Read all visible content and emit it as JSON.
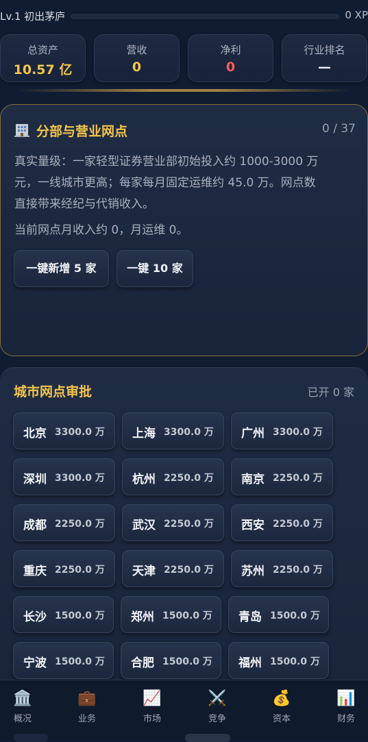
{
  "xp": {
    "level": "Lv.1 初出茅庐",
    "value": "0 XP"
  },
  "stats": [
    {
      "label": "总资产",
      "value": "10.57 亿"
    },
    {
      "label": "营收",
      "value": "0"
    },
    {
      "label": "净利",
      "value": "0"
    },
    {
      "label": "行业排名",
      "value": "—"
    }
  ],
  "branch": {
    "title": "分部与营业网点",
    "count": "0 / 37",
    "desc_lines": [
      "真实量级：一家轻型证券营业部初始投入约 1000-3000 万",
      "元，一线城市更高；每家每月固定运维约 45.0 万。网点数",
      "直接带来经纪与代销收入。"
    ],
    "current": "当前网点月收入约 0，月运维 0。",
    "buttons": [
      "一键新增 5 家",
      "一键 10 家"
    ]
  },
  "cities": {
    "title": "城市网点审批",
    "opened": "已开 0 家",
    "items": [
      {
        "name": "北京",
        "price": "3300.0 万"
      },
      {
        "name": "上海",
        "price": "3300.0 万"
      },
      {
        "name": "广州",
        "price": "3300.0 万"
      },
      {
        "name": "深圳",
        "price": "3300.0 万"
      },
      {
        "name": "杭州",
        "price": "2250.0 万"
      },
      {
        "name": "南京",
        "price": "2250.0 万"
      },
      {
        "name": "成都",
        "price": "2250.0 万"
      },
      {
        "name": "武汉",
        "price": "2250.0 万"
      },
      {
        "name": "西安",
        "price": "2250.0 万"
      },
      {
        "name": "重庆",
        "price": "2250.0 万"
      },
      {
        "name": "天津",
        "price": "2250.0 万"
      },
      {
        "name": "苏州",
        "price": "2250.0 万"
      },
      {
        "name": "长沙",
        "price": "1500.0 万"
      },
      {
        "name": "郑州",
        "price": "1500.0 万"
      },
      {
        "name": "青岛",
        "price": "1500.0 万"
      },
      {
        "name": "宁波",
        "price": "1500.0 万"
      },
      {
        "name": "合肥",
        "price": "1500.0 万"
      },
      {
        "name": "福州",
        "price": "1500.0 万"
      }
    ]
  },
  "nav": [
    {
      "label": "概况",
      "icon": "bank-icon",
      "glyph": "🏛️"
    },
    {
      "label": "业务",
      "icon": "briefcase-icon",
      "glyph": "💼"
    },
    {
      "label": "市场",
      "icon": "chart-icon",
      "glyph": "📈"
    },
    {
      "label": "竞争",
      "icon": "swords-icon",
      "glyph": "⚔️"
    },
    {
      "label": "资本",
      "icon": "money-bag-icon",
      "glyph": "💰"
    },
    {
      "label": "财务",
      "icon": "bar-chart-icon",
      "glyph": "📊"
    }
  ]
}
